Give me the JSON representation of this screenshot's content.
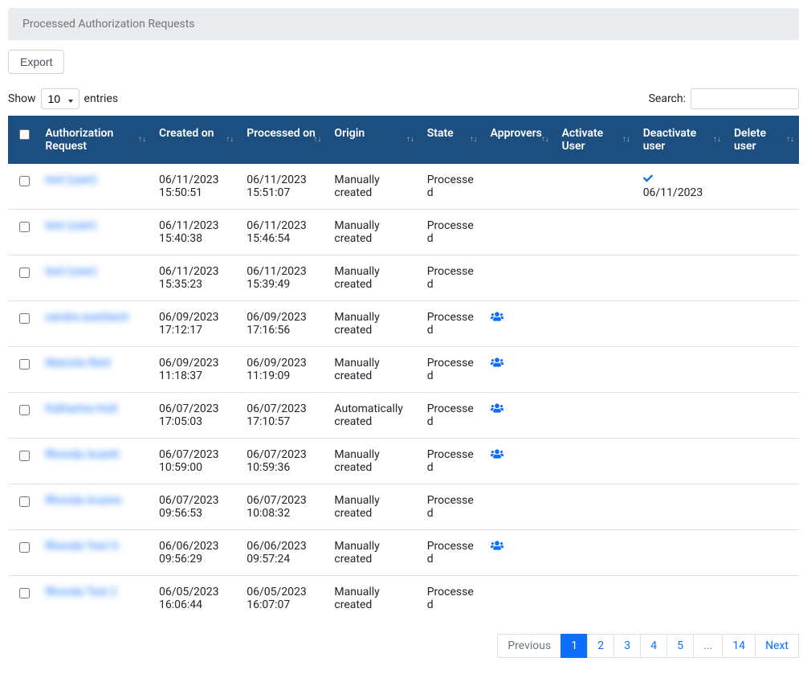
{
  "panel": {
    "title": "Processed Authorization Requests"
  },
  "toolbar": {
    "export_label": "Export"
  },
  "lengthMenu": {
    "show": "Show",
    "entries": "entries",
    "value": "10"
  },
  "search": {
    "label": "Search:",
    "value": ""
  },
  "columns": {
    "request": "Authorization Request",
    "created": "Created on",
    "processed": "Processed on",
    "origin": "Origin",
    "state": "State",
    "approvers": "Approvers",
    "activate": "Activate User",
    "deactivate": "Deactivate user",
    "delete": "Delete user"
  },
  "rows": [
    {
      "request": "test (user)",
      "created": "06/11/2023 15:50:51",
      "processed": "06/11/2023 15:51:07",
      "origin": "Manually created",
      "state": "Processed",
      "approvers": false,
      "deactivate": "06/11/2023"
    },
    {
      "request": "test (user)",
      "created": "06/11/2023 15:40:38",
      "processed": "06/11/2023 15:46:54",
      "origin": "Manually created",
      "state": "Processed",
      "approvers": false,
      "deactivate": ""
    },
    {
      "request": "test (user)",
      "created": "06/11/2023 15:35:23",
      "processed": "06/11/2023 15:39:49",
      "origin": "Manually created",
      "state": "Processed",
      "approvers": false,
      "deactivate": ""
    },
    {
      "request": "sandra auerbach",
      "created": "06/09/2023 17:12:17",
      "processed": "06/09/2023 17:16:56",
      "origin": "Manually created",
      "state": "Processed",
      "approvers": true,
      "deactivate": ""
    },
    {
      "request": "Marcela Reid",
      "created": "06/09/2023 11:18:37",
      "processed": "06/09/2023 11:19:09",
      "origin": "Manually created",
      "state": "Processed",
      "approvers": true,
      "deactivate": ""
    },
    {
      "request": "Katharina Hutt",
      "created": "06/07/2023 17:05:03",
      "processed": "06/07/2023 17:10:57",
      "origin": "Automatically created",
      "state": "Processed",
      "approvers": true,
      "deactivate": ""
    },
    {
      "request": "Rhonda Acantt",
      "created": "06/07/2023 10:59:00",
      "processed": "06/07/2023 10:59:36",
      "origin": "Manually created",
      "state": "Processed",
      "approvers": true,
      "deactivate": ""
    },
    {
      "request": "Rhonda Acanre",
      "created": "06/07/2023 09:56:53",
      "processed": "06/07/2023 10:08:32",
      "origin": "Manually created",
      "state": "Processed",
      "approvers": false,
      "deactivate": ""
    },
    {
      "request": "Rhonda Test H",
      "created": "06/06/2023 09:56:29",
      "processed": "06/06/2023 09:57:24",
      "origin": "Manually created",
      "state": "Processed",
      "approvers": true,
      "deactivate": ""
    },
    {
      "request": "Rhonda Test 2",
      "created": "06/05/2023 16:06:44",
      "processed": "06/05/2023 16:07:07",
      "origin": "Manually created",
      "state": "Processed",
      "approvers": false,
      "deactivate": ""
    }
  ],
  "pagination": {
    "previous": "Previous",
    "next": "Next",
    "pages": [
      "1",
      "2",
      "3",
      "4",
      "5",
      "...",
      "14"
    ],
    "active": "1"
  }
}
